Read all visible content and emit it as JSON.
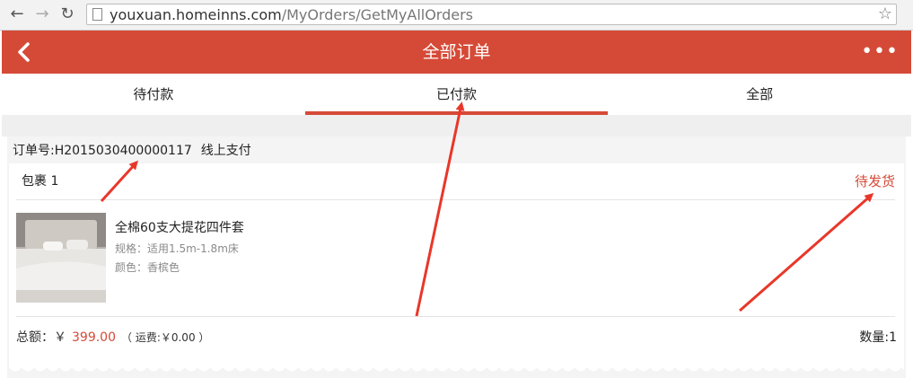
{
  "browser": {
    "url_domain": "youxuan.homeinns.com",
    "url_path": "/MyOrders/GetMyAllOrders"
  },
  "header": {
    "title": "全部订单"
  },
  "tabs": [
    {
      "label": "待付款",
      "active": false
    },
    {
      "label": "已付款",
      "active": true
    },
    {
      "label": "全部",
      "active": false
    }
  ],
  "order": {
    "number_label": "订单号:",
    "number": "H2015030400000117",
    "payment": "线上支付",
    "package_title": "包裹 1",
    "status": "待发货",
    "product": {
      "name": "全棉60支大提花四件套",
      "spec": "规格：适用1.5m-1.8m床",
      "color": "颜色：香槟色"
    },
    "total_label": "总额：￥",
    "total_amount": "399.00",
    "shipping": "（ 运费:￥0.00 ）",
    "quantity": "数量:1"
  },
  "colors": {
    "brand": "#d54a37",
    "annotation_arrow": "#e8372a"
  }
}
